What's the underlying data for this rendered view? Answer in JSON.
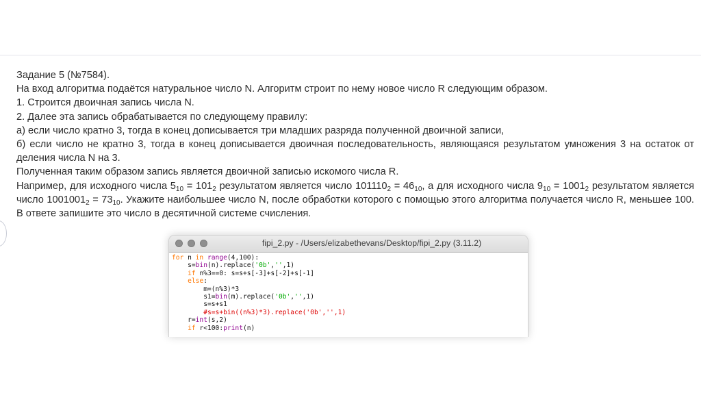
{
  "task": {
    "title": "Задание 5 (№7584).",
    "line1": "На вход алгоритма подаётся натуральное число N. Алгоритм строит по нему новое число R следующим образом.",
    "step1": "1. Строится двоичная запись числа N.",
    "step2": "2. Далее эта запись обрабатывается по следующему правилу:",
    "rule_a": "а) если число кратно 3, тогда в конец дописывается три младших разряда полученной двоичной записи,",
    "rule_b": "б) если число не кратно 3, тогда в конец дописывается двоичная последовательность, являющаяся результатом умножения 3 на остаток от деления числа N на 3.",
    "result": "Полученная таким образом запись является двоичной записью искомого числа R.",
    "example": {
      "t1": "Например, для исходного числа 5",
      "s1": "10",
      "t2": " = 101",
      "s2": "2",
      "t3": " результатом является число 101110",
      "s3": "2",
      "t4": " = 46",
      "s4": "10",
      "t5": ", а для исходного числа 9",
      "s5": "10",
      "t6": " = 1001",
      "s6": "2",
      "t7": " результатом является число 1001001",
      "s7": "2",
      "t8": " = 73",
      "s8": "10",
      "t9": ". Укажите наибольшее число N, после обработки которого с помощью этого алгоритма получается число R, меньшее 100. В ответе запишите это число в десятичной системе счисления."
    }
  },
  "ide": {
    "window_title": "fipi_2.py - /Users/elizabethevans/Desktop/fipi_2.py (3.11.2)",
    "code": {
      "l1": {
        "kw1": "for",
        "t1": " n ",
        "kw2": "in",
        "t2": " ",
        "bi1": "range",
        "t3": "(4,100):"
      },
      "l2": {
        "t1": "    s=",
        "bi1": "bin",
        "t2": "(n).replace(",
        "st1": "'0b'",
        "t3": ",",
        "st2": "''",
        "t4": ",1)"
      },
      "l3": {
        "t1": "    ",
        "kw1": "if",
        "t2": " n%3==0: s=s+s[-3]+s[-2]+s[-1]"
      },
      "l4": {
        "t1": "    ",
        "kw1": "else",
        "t2": ":"
      },
      "l5": {
        "t1": "        m=(n%3)*3"
      },
      "l6": {
        "t1": "        s1=",
        "bi1": "bin",
        "t2": "(m).replace(",
        "st1": "'0b'",
        "t3": ",",
        "st2": "''",
        "t4": ",1)"
      },
      "l7": {
        "t1": "        s=s+s1"
      },
      "l8": {
        "t1": "        ",
        "cm1": "#s=s+bin((n%3)*3).replace('0b','',1)"
      },
      "l9": {
        "t1": "    r=",
        "bi1": "int",
        "t2": "(s,2)"
      },
      "l10": {
        "t1": "    ",
        "kw1": "if",
        "t2": " r<100:",
        "bi1": "print",
        "t3": "(n)"
      }
    }
  }
}
